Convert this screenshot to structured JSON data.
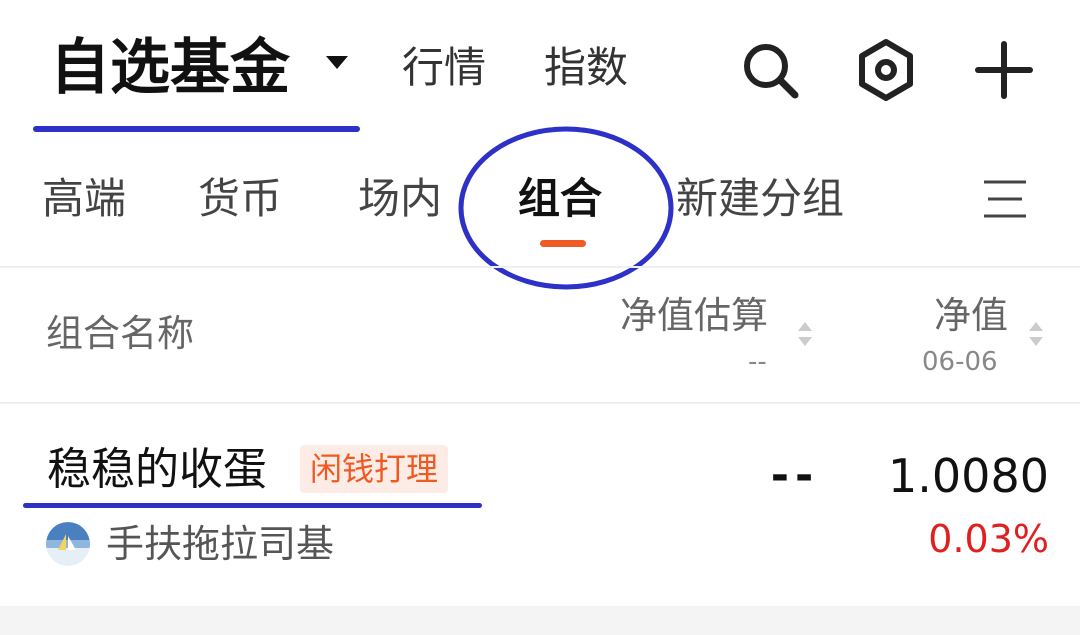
{
  "header": {
    "title": "自选基金",
    "nav_links": [
      "行情",
      "指数"
    ],
    "icons": [
      "search-icon",
      "hexagon-settings-icon",
      "plus-icon"
    ]
  },
  "tabs": {
    "items": [
      "高端",
      "货币",
      "场内",
      "组合",
      "新建分组"
    ],
    "active": "组合",
    "menu_icon": "menu-lines-icon"
  },
  "list_header": {
    "name_col": "组合名称",
    "estimate_col": "净值估算",
    "estimate_sub": "--",
    "nav_col": "净值",
    "nav_date": "06-06"
  },
  "rows": [
    {
      "name": "稳稳的收蛋",
      "tag": "闲钱打理",
      "manager": "手扶拖拉司基",
      "estimate": "--",
      "nav": "1.0080",
      "change": "0.03%"
    }
  ],
  "colors": {
    "accent": "#f05a24",
    "annotation": "#2d31c8",
    "rise": "#e02020",
    "tag_bg": "#fdece6"
  }
}
